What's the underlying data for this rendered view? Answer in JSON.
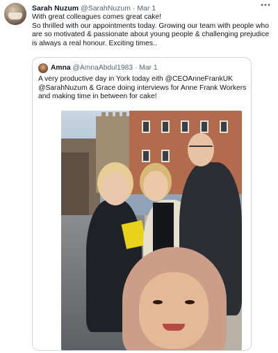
{
  "tweet": {
    "author_name": "Sarah Nuzum",
    "author_handle": "@SarahNuzum",
    "separator": "·",
    "date": "Mar 1",
    "more_icon": "more-horizontal-icon",
    "text_lines": [
      "With great colleagues comes great cake!",
      "So thrilled with our appointments today. Growing our team with people who are so motivated & passionate about young people & challenging prejudice is always a real honour. Exciting times.."
    ]
  },
  "quoted_tweet": {
    "author_name": "Amna",
    "author_handle": "@AmnaAbdul1983",
    "separator": "·",
    "date": "Mar 1",
    "text": "A very productive day in York today eith @CEOAnneFrankUK @SarahNuzum & Grace doing interviews for Anne Frank Workers and making time in between  for cake!"
  },
  "colors": {
    "text_primary": "#0f1419",
    "text_secondary": "#536471",
    "border": "#cfd9de"
  }
}
